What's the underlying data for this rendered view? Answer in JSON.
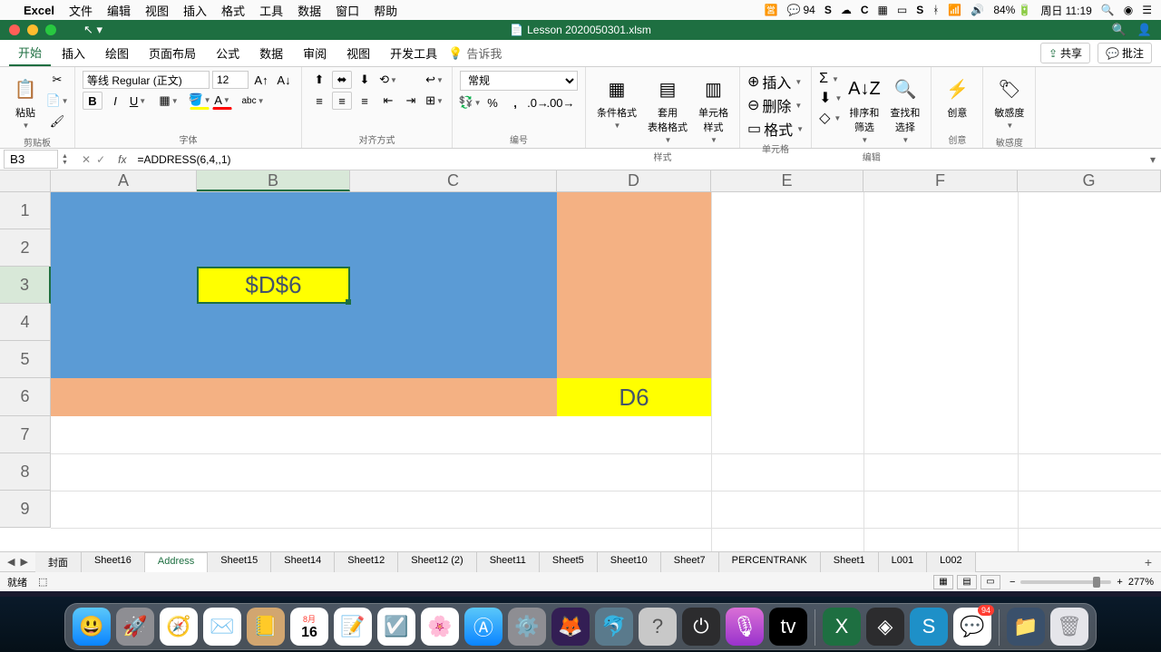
{
  "mac_menu": {
    "app": "Excel",
    "items": [
      "文件",
      "编辑",
      "视图",
      "插入",
      "格式",
      "工具",
      "数据",
      "窗口",
      "帮助"
    ],
    "wechat_count": "94",
    "battery": "84%",
    "datetime": "周日 11:19"
  },
  "window": {
    "title": "Lesson 2020050301.xlsm"
  },
  "ribbon_tabs": {
    "tabs": [
      "开始",
      "插入",
      "绘图",
      "页面布局",
      "公式",
      "数据",
      "审阅",
      "视图",
      "开发工具"
    ],
    "active": "开始",
    "tellme": "告诉我",
    "share": "共享",
    "comments": "批注"
  },
  "ribbon": {
    "clipboard": {
      "paste": "粘贴",
      "label": "剪贴板"
    },
    "font": {
      "name": "等线 Regular (正文)",
      "size": "12",
      "label": "字体"
    },
    "align": {
      "label": "对齐方式"
    },
    "number": {
      "format": "常规",
      "label": "编号"
    },
    "styles": {
      "cond": "条件格式",
      "table": "套用\n表格格式",
      "cell": "单元格\n样式",
      "label": "样式"
    },
    "cells": {
      "insert": "插入",
      "delete": "删除",
      "format": "格式",
      "label": "单元格"
    },
    "editing": {
      "sort": "排序和\n筛选",
      "find": "查找和\n选择",
      "label": "编辑"
    },
    "ideas": {
      "btn": "创意",
      "label": "创意"
    },
    "sensitivity": {
      "btn": "敏感度",
      "label": "敏感度"
    }
  },
  "formula_bar": {
    "namebox": "B3",
    "formula": "=ADDRESS(6,4,,1)"
  },
  "grid": {
    "columns": [
      "A",
      "B",
      "C",
      "D",
      "E",
      "F",
      "G"
    ],
    "rows": [
      "1",
      "2",
      "3",
      "4",
      "5",
      "6",
      "7",
      "8",
      "9"
    ],
    "sel_col": "B",
    "sel_row": "3",
    "cells": {
      "B3": "$D$6",
      "D6": "D6"
    }
  },
  "sheets": {
    "tabs": [
      "封面",
      "Sheet16",
      "Address",
      "Sheet15",
      "Sheet14",
      "Sheet12",
      "Sheet12 (2)",
      "Sheet11",
      "Sheet5",
      "Sheet10",
      "Sheet7",
      "PERCENTRANK",
      "Sheet1",
      "L001",
      "L002"
    ],
    "active": "Address"
  },
  "status": {
    "ready": "就绪",
    "zoom": "277%"
  },
  "dock": {
    "apps": [
      "finder",
      "launchpad",
      "safari",
      "mail",
      "contacts",
      "calendar",
      "notes",
      "reminders",
      "photos",
      "appstore",
      "settings",
      "firefox",
      "mysql",
      "help",
      "power",
      "podcasts",
      "appletv",
      "excel",
      "wondershare",
      "snagit",
      "wechat",
      "folder",
      "trash"
    ],
    "cal_day": "16",
    "wechat_badge": "94"
  }
}
